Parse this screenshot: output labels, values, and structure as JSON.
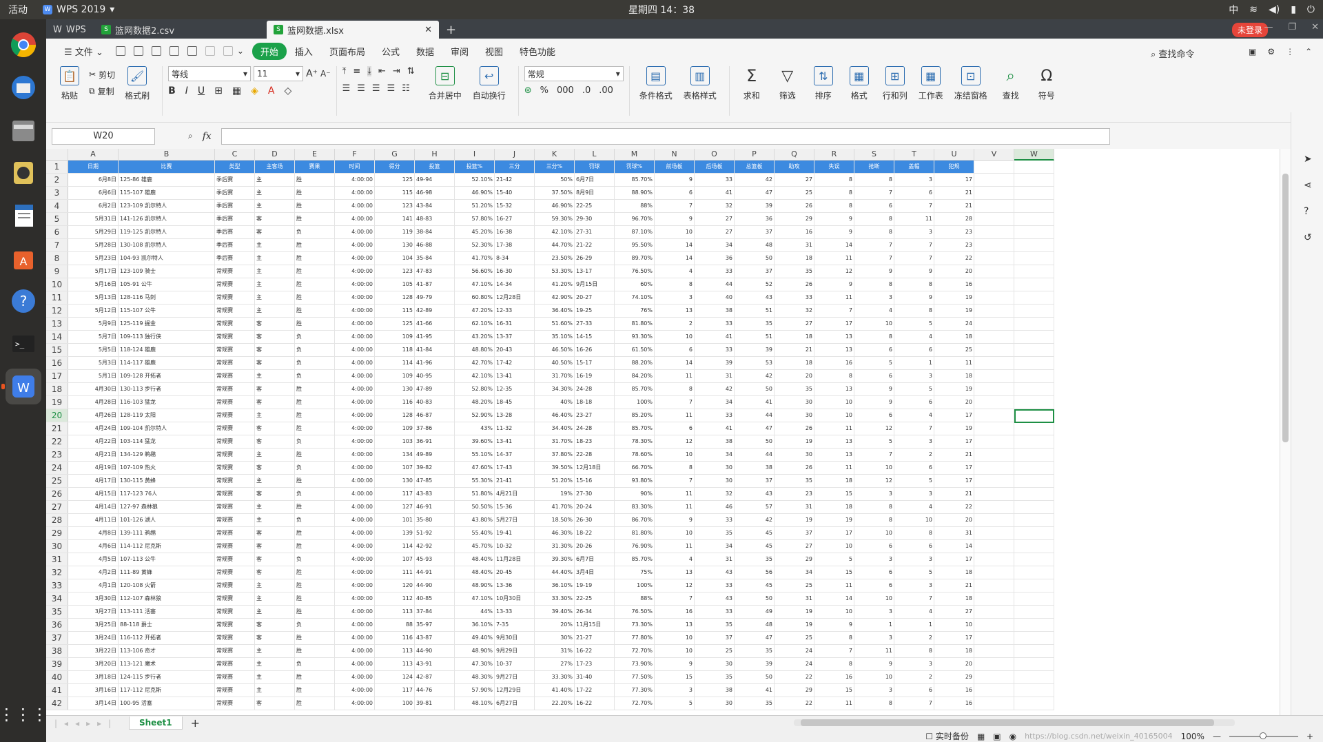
{
  "topbar": {
    "activities": "活动",
    "app_name": "WPS 2019",
    "clock": "星期四 14：38",
    "ime": "中"
  },
  "dock": {
    "items": [
      "chrome-icon",
      "thunderbird-icon",
      "files-icon",
      "rhythmbox-icon",
      "writer-icon",
      "software-center-icon",
      "help-icon",
      "terminal-icon",
      "wps-icon"
    ]
  },
  "tabs": {
    "home": "WPS",
    "csv": "篮网数据2.csv",
    "xlsx": "篮网数据.xlsx",
    "login": "未登录"
  },
  "menu": {
    "file": "文件",
    "items": [
      "开始",
      "插入",
      "页面布局",
      "公式",
      "数据",
      "审阅",
      "视图",
      "特色功能"
    ],
    "search": "查找命令"
  },
  "ribbon": {
    "paste": "粘贴",
    "cut": "剪切",
    "copy": "复制",
    "format_painter": "格式刷",
    "font": "等线",
    "size": "11",
    "number_format": "常规",
    "merge": "合并居中",
    "wrap": "自动换行",
    "cond_format": "条件格式",
    "table_style": "表格样式",
    "sum": "求和",
    "filter": "筛选",
    "sort": "排序",
    "format": "格式",
    "rowcol": "行和列",
    "worksheet": "工作表",
    "freeze": "冻结窗格",
    "find": "查找",
    "symbol": "符号"
  },
  "formula": {
    "namebox": "W20",
    "fx": "fx",
    "value": ""
  },
  "columns": [
    "A",
    "B",
    "C",
    "D",
    "E",
    "F",
    "G",
    "H",
    "I",
    "J",
    "K",
    "L",
    "M",
    "N",
    "O",
    "P",
    "Q",
    "R",
    "S",
    "T",
    "U",
    "V",
    "W"
  ],
  "header_row": [
    "日期",
    "比赛",
    "类型",
    "主客场",
    "赛果",
    "时间",
    "得分",
    "投篮",
    "投篮%",
    "三分",
    "三分%",
    "罚球",
    "罚球%",
    "前场板",
    "后场板",
    "总篮板",
    "助攻",
    "失误",
    "抢断",
    "盖帽",
    "犯规"
  ],
  "rows": [
    [
      "6月8日",
      "125-86 雄鹿",
      "季后赛",
      "主",
      "胜",
      "4:00:00",
      "125",
      "49-94",
      "52.10%",
      "21-42",
      "50%",
      "6月7日",
      "85.70%",
      "9",
      "33",
      "42",
      "27",
      "8",
      "8",
      "3",
      "17"
    ],
    [
      "6月6日",
      "115-107 雄鹿",
      "季后赛",
      "主",
      "胜",
      "4:00:00",
      "115",
      "46-98",
      "46.90%",
      "15-40",
      "37.50%",
      "8月9日",
      "88.90%",
      "6",
      "41",
      "47",
      "25",
      "8",
      "7",
      "6",
      "21"
    ],
    [
      "6月2日",
      "123-109 凯尔特人",
      "季后赛",
      "主",
      "胜",
      "4:00:00",
      "123",
      "43-84",
      "51.20%",
      "15-32",
      "46.90%",
      "22-25",
      "88%",
      "7",
      "32",
      "39",
      "26",
      "8",
      "6",
      "7",
      "21"
    ],
    [
      "5月31日",
      "141-126 凯尔特人",
      "季后赛",
      "客",
      "胜",
      "4:00:00",
      "141",
      "48-83",
      "57.80%",
      "16-27",
      "59.30%",
      "29-30",
      "96.70%",
      "9",
      "27",
      "36",
      "29",
      "9",
      "8",
      "11",
      "28"
    ],
    [
      "5月29日",
      "119-125 凯尔特人",
      "季后赛",
      "客",
      "负",
      "4:00:00",
      "119",
      "38-84",
      "45.20%",
      "16-38",
      "42.10%",
      "27-31",
      "87.10%",
      "10",
      "27",
      "37",
      "16",
      "9",
      "8",
      "3",
      "23"
    ],
    [
      "5月28日",
      "130-108 凯尔特人",
      "季后赛",
      "主",
      "胜",
      "4:00:00",
      "130",
      "46-88",
      "52.30%",
      "17-38",
      "44.70%",
      "21-22",
      "95.50%",
      "14",
      "34",
      "48",
      "31",
      "14",
      "7",
      "7",
      "23"
    ],
    [
      "5月23日",
      "104-93 凯尔特人",
      "季后赛",
      "主",
      "胜",
      "4:00:00",
      "104",
      "35-84",
      "41.70%",
      "8-34",
      "23.50%",
      "26-29",
      "89.70%",
      "14",
      "36",
      "50",
      "18",
      "11",
      "7",
      "7",
      "22"
    ],
    [
      "5月17日",
      "123-109 骑士",
      "常规赛",
      "主",
      "胜",
      "4:00:00",
      "123",
      "47-83",
      "56.60%",
      "16-30",
      "53.30%",
      "13-17",
      "76.50%",
      "4",
      "33",
      "37",
      "35",
      "12",
      "9",
      "9",
      "20"
    ],
    [
      "5月16日",
      "105-91 公牛",
      "常规赛",
      "主",
      "胜",
      "4:00:00",
      "105",
      "41-87",
      "47.10%",
      "14-34",
      "41.20%",
      "9月15日",
      "60%",
      "8",
      "44",
      "52",
      "26",
      "9",
      "8",
      "8",
      "16"
    ],
    [
      "5月13日",
      "128-116 马刺",
      "常规赛",
      "主",
      "胜",
      "4:00:00",
      "128",
      "49-79",
      "60.80%",
      "12月28日",
      "42.90%",
      "20-27",
      "74.10%",
      "3",
      "40",
      "43",
      "33",
      "11",
      "3",
      "9",
      "19"
    ],
    [
      "5月12日",
      "115-107 公牛",
      "常规赛",
      "主",
      "胜",
      "4:00:00",
      "115",
      "42-89",
      "47.20%",
      "12-33",
      "36.40%",
      "19-25",
      "76%",
      "13",
      "38",
      "51",
      "32",
      "7",
      "4",
      "8",
      "19"
    ],
    [
      "5月9日",
      "125-119 掘金",
      "常规赛",
      "客",
      "胜",
      "4:00:00",
      "125",
      "41-66",
      "62.10%",
      "16-31",
      "51.60%",
      "27-33",
      "81.80%",
      "2",
      "33",
      "35",
      "27",
      "17",
      "10",
      "5",
      "24"
    ],
    [
      "5月7日",
      "109-113 独行侠",
      "常规赛",
      "客",
      "负",
      "4:00:00",
      "109",
      "41-95",
      "43.20%",
      "13-37",
      "35.10%",
      "14-15",
      "93.30%",
      "10",
      "41",
      "51",
      "18",
      "13",
      "8",
      "4",
      "18"
    ],
    [
      "5月5日",
      "118-124 雄鹿",
      "常规赛",
      "客",
      "负",
      "4:00:00",
      "118",
      "41-84",
      "48.80%",
      "20-43",
      "46.50%",
      "16-26",
      "61.50%",
      "6",
      "33",
      "39",
      "21",
      "13",
      "6",
      "6",
      "25"
    ],
    [
      "5月3日",
      "114-117 雄鹿",
      "常规赛",
      "客",
      "负",
      "4:00:00",
      "114",
      "41-96",
      "42.70%",
      "17-42",
      "40.50%",
      "15-17",
      "88.20%",
      "14",
      "39",
      "53",
      "18",
      "16",
      "5",
      "1",
      "11"
    ],
    [
      "5月1日",
      "109-128 开拓者",
      "常规赛",
      "主",
      "负",
      "4:00:00",
      "109",
      "40-95",
      "42.10%",
      "13-41",
      "31.70%",
      "16-19",
      "84.20%",
      "11",
      "31",
      "42",
      "20",
      "8",
      "6",
      "3",
      "18"
    ],
    [
      "4月30日",
      "130-113 步行者",
      "常规赛",
      "客",
      "胜",
      "4:00:00",
      "130",
      "47-89",
      "52.80%",
      "12-35",
      "34.30%",
      "24-28",
      "85.70%",
      "8",
      "42",
      "50",
      "35",
      "13",
      "9",
      "5",
      "19"
    ],
    [
      "4月28日",
      "116-103 猛龙",
      "常规赛",
      "客",
      "胜",
      "4:00:00",
      "116",
      "40-83",
      "48.20%",
      "18-45",
      "40%",
      "18-18",
      "100%",
      "7",
      "34",
      "41",
      "30",
      "10",
      "9",
      "6",
      "20"
    ],
    [
      "4月26日",
      "128-119 太阳",
      "常规赛",
      "主",
      "胜",
      "4:00:00",
      "128",
      "46-87",
      "52.90%",
      "13-28",
      "46.40%",
      "23-27",
      "85.20%",
      "11",
      "33",
      "44",
      "30",
      "10",
      "6",
      "4",
      "17"
    ],
    [
      "4月24日",
      "109-104 凯尔特人",
      "常规赛",
      "客",
      "胜",
      "4:00:00",
      "109",
      "37-86",
      "43%",
      "11-32",
      "34.40%",
      "24-28",
      "85.70%",
      "6",
      "41",
      "47",
      "26",
      "11",
      "12",
      "7",
      "19"
    ],
    [
      "4月22日",
      "103-114 猛龙",
      "常规赛",
      "客",
      "负",
      "4:00:00",
      "103",
      "36-91",
      "39.60%",
      "13-41",
      "31.70%",
      "18-23",
      "78.30%",
      "12",
      "38",
      "50",
      "19",
      "13",
      "5",
      "3",
      "17"
    ],
    [
      "4月21日",
      "134-129 鹈鹕",
      "常规赛",
      "主",
      "胜",
      "4:00:00",
      "134",
      "49-89",
      "55.10%",
      "14-37",
      "37.80%",
      "22-28",
      "78.60%",
      "10",
      "34",
      "44",
      "30",
      "13",
      "7",
      "2",
      "21"
    ],
    [
      "4月19日",
      "107-109 热火",
      "常规赛",
      "客",
      "负",
      "4:00:00",
      "107",
      "39-82",
      "47.60%",
      "17-43",
      "39.50%",
      "12月18日",
      "66.70%",
      "8",
      "30",
      "38",
      "26",
      "11",
      "10",
      "6",
      "17"
    ],
    [
      "4月17日",
      "130-115 黄蜂",
      "常规赛",
      "主",
      "胜",
      "4:00:00",
      "130",
      "47-85",
      "55.30%",
      "21-41",
      "51.20%",
      "15-16",
      "93.80%",
      "7",
      "30",
      "37",
      "35",
      "18",
      "12",
      "5",
      "17"
    ],
    [
      "4月15日",
      "117-123 76人",
      "常规赛",
      "客",
      "负",
      "4:00:00",
      "117",
      "43-83",
      "51.80%",
      "4月21日",
      "19%",
      "27-30",
      "90%",
      "11",
      "32",
      "43",
      "23",
      "15",
      "3",
      "3",
      "21"
    ],
    [
      "4月14日",
      "127-97 森林狼",
      "常规赛",
      "主",
      "胜",
      "4:00:00",
      "127",
      "46-91",
      "50.50%",
      "15-36",
      "41.70%",
      "20-24",
      "83.30%",
      "11",
      "46",
      "57",
      "31",
      "18",
      "8",
      "4",
      "22"
    ],
    [
      "4月11日",
      "101-126 湖人",
      "常规赛",
      "主",
      "负",
      "4:00:00",
      "101",
      "35-80",
      "43.80%",
      "5月27日",
      "18.50%",
      "26-30",
      "86.70%",
      "9",
      "33",
      "42",
      "19",
      "19",
      "8",
      "10",
      "20"
    ],
    [
      "4月8日",
      "139-111 鹈鹕",
      "常规赛",
      "客",
      "胜",
      "4:00:00",
      "139",
      "51-92",
      "55.40%",
      "19-41",
      "46.30%",
      "18-22",
      "81.80%",
      "10",
      "35",
      "45",
      "37",
      "17",
      "10",
      "8",
      "31"
    ],
    [
      "4月6日",
      "114-112 尼克斯",
      "常规赛",
      "客",
      "胜",
      "4:00:00",
      "114",
      "42-92",
      "45.70%",
      "10-32",
      "31.30%",
      "20-26",
      "76.90%",
      "11",
      "34",
      "45",
      "27",
      "10",
      "6",
      "6",
      "14"
    ],
    [
      "4月5日",
      "107-113 公牛",
      "常规赛",
      "客",
      "负",
      "4:00:00",
      "107",
      "45-93",
      "48.40%",
      "11月28日",
      "39.30%",
      "6月7日",
      "85.70%",
      "4",
      "31",
      "35",
      "29",
      "5",
      "3",
      "3",
      "17"
    ],
    [
      "4月2日",
      "111-89 黄蜂",
      "常规赛",
      "客",
      "胜",
      "4:00:00",
      "111",
      "44-91",
      "48.40%",
      "20-45",
      "44.40%",
      "3月4日",
      "75%",
      "13",
      "43",
      "56",
      "34",
      "15",
      "6",
      "5",
      "18"
    ],
    [
      "4月1日",
      "120-108 火箭",
      "常规赛",
      "主",
      "胜",
      "4:00:00",
      "120",
      "44-90",
      "48.90%",
      "13-36",
      "36.10%",
      "19-19",
      "100%",
      "12",
      "33",
      "45",
      "25",
      "11",
      "6",
      "3",
      "21"
    ],
    [
      "3月30日",
      "112-107 森林狼",
      "常规赛",
      "主",
      "胜",
      "4:00:00",
      "112",
      "40-85",
      "47.10%",
      "10月30日",
      "33.30%",
      "22-25",
      "88%",
      "7",
      "43",
      "50",
      "31",
      "14",
      "10",
      "7",
      "18"
    ],
    [
      "3月27日",
      "113-111 活塞",
      "常规赛",
      "主",
      "胜",
      "4:00:00",
      "113",
      "37-84",
      "44%",
      "13-33",
      "39.40%",
      "26-34",
      "76.50%",
      "16",
      "33",
      "49",
      "19",
      "10",
      "3",
      "4",
      "27"
    ],
    [
      "3月25日",
      "88-118 爵士",
      "常规赛",
      "客",
      "负",
      "4:00:00",
      "88",
      "35-97",
      "36.10%",
      "7-35",
      "20%",
      "11月15日",
      "73.30%",
      "13",
      "35",
      "48",
      "19",
      "9",
      "1",
      "1",
      "10"
    ],
    [
      "3月24日",
      "116-112 开拓者",
      "常规赛",
      "客",
      "胜",
      "4:00:00",
      "116",
      "43-87",
      "49.40%",
      "9月30日",
      "30%",
      "21-27",
      "77.80%",
      "10",
      "37",
      "47",
      "25",
      "8",
      "3",
      "2",
      "17"
    ],
    [
      "3月22日",
      "113-106 奇才",
      "常规赛",
      "主",
      "胜",
      "4:00:00",
      "113",
      "44-90",
      "48.90%",
      "9月29日",
      "31%",
      "16-22",
      "72.70%",
      "10",
      "25",
      "35",
      "24",
      "7",
      "11",
      "8",
      "18"
    ],
    [
      "3月20日",
      "113-121 魔术",
      "常规赛",
      "主",
      "负",
      "4:00:00",
      "113",
      "43-91",
      "47.30%",
      "10-37",
      "27%",
      "17-23",
      "73.90%",
      "9",
      "30",
      "39",
      "24",
      "8",
      "9",
      "3",
      "20"
    ],
    [
      "3月18日",
      "124-115 步行者",
      "常规赛",
      "主",
      "胜",
      "4:00:00",
      "124",
      "42-87",
      "48.30%",
      "9月27日",
      "33.30%",
      "31-40",
      "77.50%",
      "15",
      "35",
      "50",
      "22",
      "16",
      "10",
      "2",
      "29"
    ],
    [
      "3月16日",
      "117-112 尼克斯",
      "常规赛",
      "主",
      "胜",
      "4:00:00",
      "117",
      "44-76",
      "57.90%",
      "12月29日",
      "41.40%",
      "17-22",
      "77.30%",
      "3",
      "38",
      "41",
      "29",
      "15",
      "3",
      "6",
      "16"
    ],
    [
      "3月14日",
      "100-95 活塞",
      "常规赛",
      "客",
      "胜",
      "4:00:00",
      "100",
      "39-81",
      "48.10%",
      "6月27日",
      "22.20%",
      "16-22",
      "72.70%",
      "5",
      "30",
      "35",
      "22",
      "11",
      "8",
      "7",
      "16"
    ]
  ],
  "sheet": {
    "name": "Sheet1"
  },
  "status": {
    "backup": "实时备份",
    "zoom": "100%",
    "watermark": "https://blog.csdn.net/weixin_40165004"
  }
}
